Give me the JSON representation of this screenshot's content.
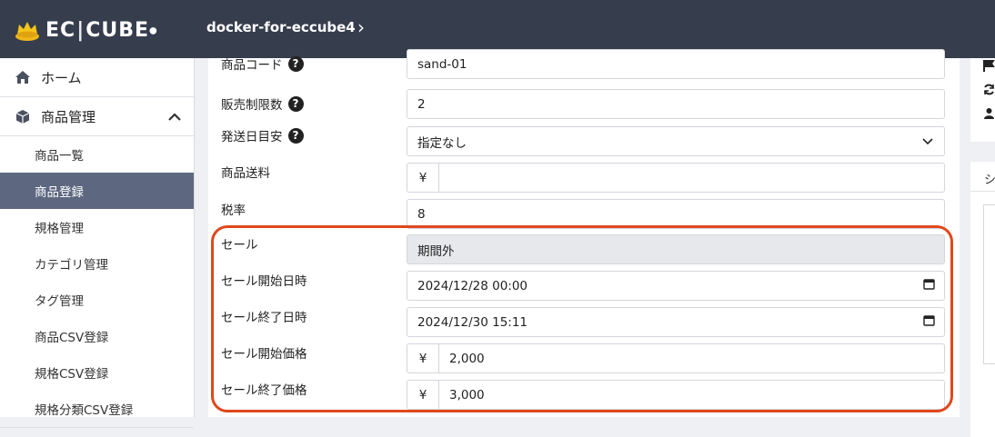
{
  "header": {
    "logo_text": "EC|CUBE",
    "logo_main": "EC",
    "logo_sub": "CUBE",
    "shop_name": "docker-for-eccube4",
    "chevron": "›"
  },
  "sidebar": {
    "home_label": "ホーム",
    "product_label": "商品管理",
    "items": [
      {
        "label": "商品一覧"
      },
      {
        "label": "商品登録"
      },
      {
        "label": "規格管理"
      },
      {
        "label": "カテゴリ管理"
      },
      {
        "label": "タグ管理"
      },
      {
        "label": "商品CSV登録"
      },
      {
        "label": "規格CSV登録"
      },
      {
        "label": "規格分類CSV登録"
      }
    ]
  },
  "form": {
    "product_code": {
      "label": "商品コード",
      "value": "sand-01"
    },
    "sale_limit": {
      "label": "販売制限数",
      "value": "2"
    },
    "delivery": {
      "label": "発送日目安",
      "value": "指定なし"
    },
    "shipping_fee": {
      "label": "商品送料",
      "currency": "¥",
      "value": ""
    },
    "tax_rate": {
      "label": "税率",
      "value": "8"
    },
    "sale": {
      "label": "セール",
      "value": "期間外"
    },
    "sale_start": {
      "label": "セール開始日時",
      "value": "2024/12/28 00:00"
    },
    "sale_end": {
      "label": "セール終了日時",
      "value": "2024/12/30 15:11"
    },
    "sale_start_price": {
      "label": "セール開始価格",
      "currency": "¥",
      "value": "2,000"
    },
    "sale_end_price": {
      "label": "セール終了価格",
      "currency": "¥",
      "value": "3,000"
    }
  },
  "right_panel": {
    "title": "シ"
  },
  "colors": {
    "header_bg": "#363d4d",
    "active_nav": "#5d6880",
    "highlight": "#e0471c"
  }
}
